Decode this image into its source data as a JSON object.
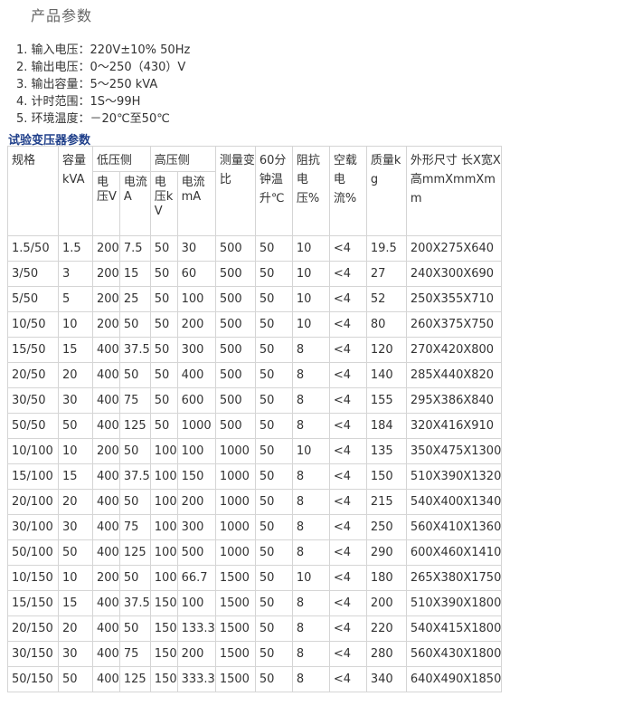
{
  "title": "产品参数",
  "specs": [
    "1. 输入电压：220V±10% 50Hz",
    "2. 输出电压：0～250（430）V",
    "3. 输出容量：5～250 kVA",
    "4. 计时范围：1S～99H",
    "5. 环境温度：－20℃至50℃"
  ],
  "table_title": "试验变压器参数",
  "headers": {
    "spec": "规格",
    "capacity": "容量kVA",
    "low_side": "低压侧",
    "high_side": "高压侧",
    "ratio": "测量变比",
    "temp_rise": "60分钟温升℃",
    "impedance": "阻抗电压%",
    "no_load_current": "空载电流%",
    "mass": "质量kg",
    "dimensions": "外形尺寸 长X宽X高mmXmmXmm",
    "low_voltage": "电压V",
    "low_current": "电流A",
    "high_voltage": "电压kV",
    "high_current": "电流mA"
  },
  "rows": [
    [
      "1.5/50",
      "1.5",
      "200",
      "7.5",
      "50",
      "30",
      "500",
      "50",
      "10",
      "<4",
      "19.5",
      "200X275X640"
    ],
    [
      "3/50",
      "3",
      "200",
      "15",
      "50",
      "60",
      "500",
      "50",
      "10",
      "<4",
      "27",
      "240X300X690"
    ],
    [
      "5/50",
      "5",
      "200",
      "25",
      "50",
      "100",
      "500",
      "50",
      "10",
      "<4",
      "52",
      "250X355X710"
    ],
    [
      "10/50",
      "10",
      "200",
      "50",
      "50",
      "200",
      "500",
      "50",
      "10",
      "<4",
      "80",
      "260X375X750"
    ],
    [
      "15/50",
      "15",
      "400",
      "37.5",
      "50",
      "300",
      "500",
      "50",
      "8",
      "<4",
      "120",
      "270X420X800"
    ],
    [
      "20/50",
      "20",
      "400",
      "50",
      "50",
      "400",
      "500",
      "50",
      "8",
      "<4",
      "140",
      "285X440X820"
    ],
    [
      "30/50",
      "30",
      "400",
      "75",
      "50",
      "600",
      "500",
      "50",
      "8",
      "<4",
      "155",
      "295X386X840"
    ],
    [
      "50/50",
      "50",
      "400",
      "125",
      "50",
      "1000",
      "500",
      "50",
      "8",
      "<4",
      "184",
      "320X416X910"
    ],
    [
      "10/100",
      "10",
      "200",
      "50",
      "100",
      "100",
      "1000",
      "50",
      "10",
      "<4",
      "135",
      "350X475X1300"
    ],
    [
      "15/100",
      "15",
      "400",
      "37.5",
      "100",
      "150",
      "1000",
      "50",
      "8",
      "<4",
      "150",
      "510X390X1320"
    ],
    [
      "20/100",
      "20",
      "400",
      "50",
      "100",
      "200",
      "1000",
      "50",
      "8",
      "<4",
      "215",
      "540X400X1340"
    ],
    [
      "30/100",
      "30",
      "400",
      "75",
      "100",
      "300",
      "1000",
      "50",
      "8",
      "<4",
      "250",
      "560X410X1360"
    ],
    [
      "50/100",
      "50",
      "400",
      "125",
      "100",
      "500",
      "1000",
      "50",
      "8",
      "<4",
      "290",
      "600X460X1410"
    ],
    [
      "10/150",
      "10",
      "200",
      "50",
      "100",
      "66.7",
      "1500",
      "50",
      "10",
      "<4",
      "180",
      "265X380X1750"
    ],
    [
      "15/150",
      "15",
      "400",
      "37.5",
      "150",
      "100",
      "1500",
      "50",
      "8",
      "<4",
      "200",
      "510X390X1800"
    ],
    [
      "20/150",
      "20",
      "400",
      "50",
      "150",
      "133.3",
      "1500",
      "50",
      "8",
      "<4",
      "220",
      "540X415X1800"
    ],
    [
      "30/150",
      "30",
      "400",
      "75",
      "150",
      "200",
      "1500",
      "50",
      "8",
      "<4",
      "280",
      "560X430X1800"
    ],
    [
      "50/150",
      "50",
      "400",
      "125",
      "150",
      "333.3",
      "1500",
      "50",
      "8",
      "<4",
      "340",
      "640X490X1850"
    ]
  ]
}
